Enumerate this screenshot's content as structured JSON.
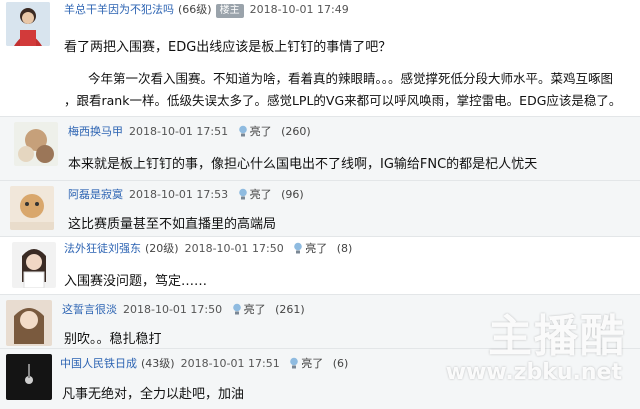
{
  "op": {
    "author": "羊总干羊因为不犯法吗",
    "level": "(66级)",
    "badge": "楼主",
    "time": "2018-10-01 17:49",
    "line1": "看了两把入围赛，EDG出线应该是板上钉钉的事情了吧？",
    "line2": "今年第一次看入围赛。不知道为啥，看着真的辣眼睛。。。感觉撑死低分段大师水平。菜鸡互啄图",
    "line3": "，跟看rank一样。低级失误太多了。感觉LPL的VG来都可以呼风唤雨，掌控雷电。EDG应该是稳了。"
  },
  "replies": [
    {
      "author": "梅西换马甲",
      "level": "",
      "time": "2018-10-01 17:51",
      "like_label": "亮了",
      "likes": "(260)",
      "text": "本来就是板上钉钉的事，像担心什么国电出不了线啊，IG输给FNC的都是杞人忧天"
    },
    {
      "author": "阿磊是寂寞",
      "level": "",
      "time": "2018-10-01 17:53",
      "like_label": "亮了",
      "likes": "(96)",
      "text": "这比赛质量甚至不如直播里的高端局"
    },
    {
      "author": "法外狂徒刘强东",
      "level": "(20级)",
      "time": "2018-10-01 17:50",
      "like_label": "亮了",
      "likes": "(8)",
      "text": "入围赛没问题，笃定……"
    },
    {
      "author": "这誓言很淡",
      "level": "",
      "time": "2018-10-01 17:50",
      "like_label": "亮了",
      "likes": "(261)",
      "text": "别吹。。稳扎稳打"
    },
    {
      "author": "中国人民铁日成",
      "level": "(43级)",
      "time": "2018-10-01 17:51",
      "like_label": "亮了",
      "likes": "(6)",
      "text": "凡事无绝对，全力以赴吧，加油"
    }
  ],
  "watermark": {
    "brand": "主播酷",
    "url": "www.zbku.net"
  }
}
